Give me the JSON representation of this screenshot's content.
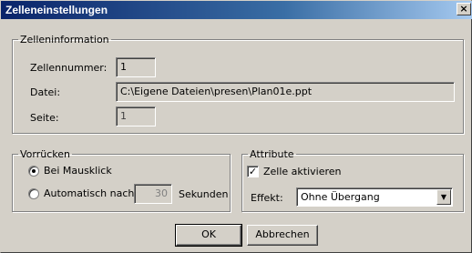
{
  "window": {
    "title": "Zelleneinstellungen",
    "close_glyph": "×"
  },
  "zelleninformation": {
    "legend": "Zelleninformation",
    "zellennummer_label": "Zellennummer:",
    "zellennummer_value": "1",
    "datei_label": "Datei:",
    "datei_value": "C:\\Eigene Dateien\\presen\\Plan01e.ppt",
    "seite_label": "Seite:",
    "seite_value": "1"
  },
  "vorruecken": {
    "legend": "Vorrücken",
    "option_klick": "Bei Mausklick",
    "option_auto": "Automatisch nach",
    "seconds_value": "30",
    "seconds_unit": "Sekunden"
  },
  "attribute": {
    "legend": "Attribute",
    "checkbox_label": "Zelle aktivieren",
    "checkbox_checked": true,
    "effekt_label": "Effekt:",
    "effekt_value": "Ohne Übergang"
  },
  "buttons": {
    "ok": "OK",
    "cancel": "Abbrechen"
  }
}
